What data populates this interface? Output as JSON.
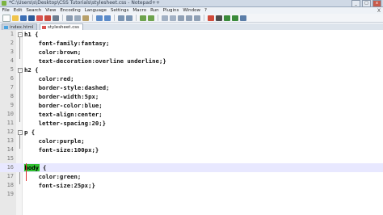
{
  "window": {
    "title": "*C:\\Users\\s\\Desktop\\CSS Tutorials\\stylesheet.css - Notepad++",
    "minimize": "_",
    "maximize": "□",
    "close": "x"
  },
  "menu": [
    "File",
    "Edit",
    "Search",
    "View",
    "Encoding",
    "Language",
    "Settings",
    "Macro",
    "Run",
    "Plugins",
    "Window",
    "?"
  ],
  "menu_close": "X",
  "tabs": [
    {
      "label": "index.html"
    },
    {
      "label": "stylesheet.css"
    }
  ],
  "active_tab": 1,
  "editor": {
    "lines": [
      {
        "n": "1",
        "text": "h1 {"
      },
      {
        "n": "2",
        "text": "    font-family:fantasy;"
      },
      {
        "n": "3",
        "text": "    color:brown;"
      },
      {
        "n": "4",
        "text": "    text-decoration:overline underline;}"
      },
      {
        "n": "5",
        "text": "h2 {"
      },
      {
        "n": "6",
        "text": "    color:red;"
      },
      {
        "n": "7",
        "text": "    border-style:dashed;"
      },
      {
        "n": "8",
        "text": "    border-width:5px;"
      },
      {
        "n": "9",
        "text": "    border-color:blue;"
      },
      {
        "n": "10",
        "text": "    text-align:center;"
      },
      {
        "n": "11",
        "text": "    letter-spacing:20;}"
      },
      {
        "n": "12",
        "text": "p {"
      },
      {
        "n": "13",
        "text": "    color:purple;"
      },
      {
        "n": "14",
        "text": "    font-size:100px;}"
      },
      {
        "n": "15",
        "text": ""
      },
      {
        "n": "16",
        "text_sel": "body",
        "text_rest": " {"
      },
      {
        "n": "17",
        "text": "    color:green;"
      },
      {
        "n": "18",
        "text": "    font-size:25px;}"
      },
      {
        "n": "19",
        "text": ""
      }
    ]
  }
}
